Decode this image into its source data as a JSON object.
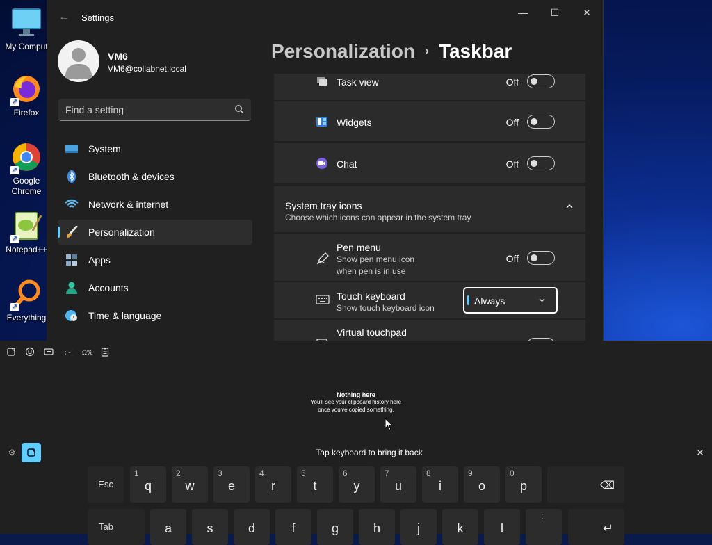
{
  "desktop": {
    "icons": [
      {
        "label": "My Comput",
        "icon": "monitor-icon"
      },
      {
        "label": "Firefox",
        "icon": "firefox-icon"
      },
      {
        "label": "Google Chrome",
        "icon": "chrome-icon"
      },
      {
        "label": "Notepad++",
        "icon": "notepadpp-icon"
      },
      {
        "label": "Everything",
        "icon": "everything-icon"
      }
    ]
  },
  "window": {
    "title": "Settings",
    "controls": {
      "minimize": "—",
      "maximize": "☐",
      "close": "✕"
    },
    "back": "←"
  },
  "profile": {
    "name": "VM6",
    "email": "VM6@collabnet.local"
  },
  "search": {
    "placeholder": "Find a setting"
  },
  "nav": {
    "items": [
      {
        "label": "System",
        "icon": "system-icon",
        "color": "#4aa3df"
      },
      {
        "label": "Bluetooth & devices",
        "icon": "bluetooth-icon",
        "color": "#3b8eea"
      },
      {
        "label": "Network & internet",
        "icon": "wifi-icon",
        "color": "#5db8f0"
      },
      {
        "label": "Personalization",
        "icon": "brush-icon",
        "color": "#e8a33d",
        "active": true
      },
      {
        "label": "Apps",
        "icon": "apps-icon",
        "color": "#7fa7c9"
      },
      {
        "label": "Accounts",
        "icon": "accounts-icon",
        "color": "#2fc4a2"
      },
      {
        "label": "Time & language",
        "icon": "time-language-icon",
        "color": "#4db6ee"
      }
    ]
  },
  "breadcrumb": {
    "parent": "Personalization",
    "separator": "›",
    "current": "Taskbar"
  },
  "settings": {
    "task_view": {
      "title": "Task view",
      "state": "Off"
    },
    "widgets": {
      "title": "Widgets",
      "state": "Off"
    },
    "chat": {
      "title": "Chat",
      "state": "Off"
    },
    "tray_section": {
      "title": "System tray icons",
      "subtitle": "Choose which icons can appear in the system tray"
    },
    "pen_menu": {
      "title": "Pen menu",
      "subtitle_line1": "Show pen menu icon",
      "subtitle_line2": "when pen is in use",
      "state": "Off"
    },
    "touch_keyboard": {
      "title": "Touch keyboard",
      "subtitle": "Show touch keyboard icon",
      "value": "Always"
    },
    "virtual_touchpad": {
      "title": "Virtual touchpad"
    }
  },
  "keyboard": {
    "clipboard": {
      "title": "Nothing here",
      "line1": "You'll see your clipboard history here",
      "line2": "once you've copied something."
    },
    "tap_message": "Tap keyboard to bring it back",
    "close": "✕",
    "row1": [
      {
        "char": "q",
        "num": "1"
      },
      {
        "char": "w",
        "num": "2"
      },
      {
        "char": "e",
        "num": "3"
      },
      {
        "char": "r",
        "num": "4"
      },
      {
        "char": "t",
        "num": "5"
      },
      {
        "char": "y",
        "num": "6"
      },
      {
        "char": "u",
        "num": "7"
      },
      {
        "char": "i",
        "num": "8"
      },
      {
        "char": "o",
        "num": "9"
      },
      {
        "char": "p",
        "num": "0"
      }
    ],
    "row2": [
      "a",
      "s",
      "d",
      "f",
      "g",
      "h",
      "j",
      "k",
      "l"
    ],
    "esc": "Esc",
    "tab": "Tab",
    "backspace": "⌫",
    "enter": "↵",
    "semicolon_hint": ":",
    "accent_color": "#60cdff"
  }
}
